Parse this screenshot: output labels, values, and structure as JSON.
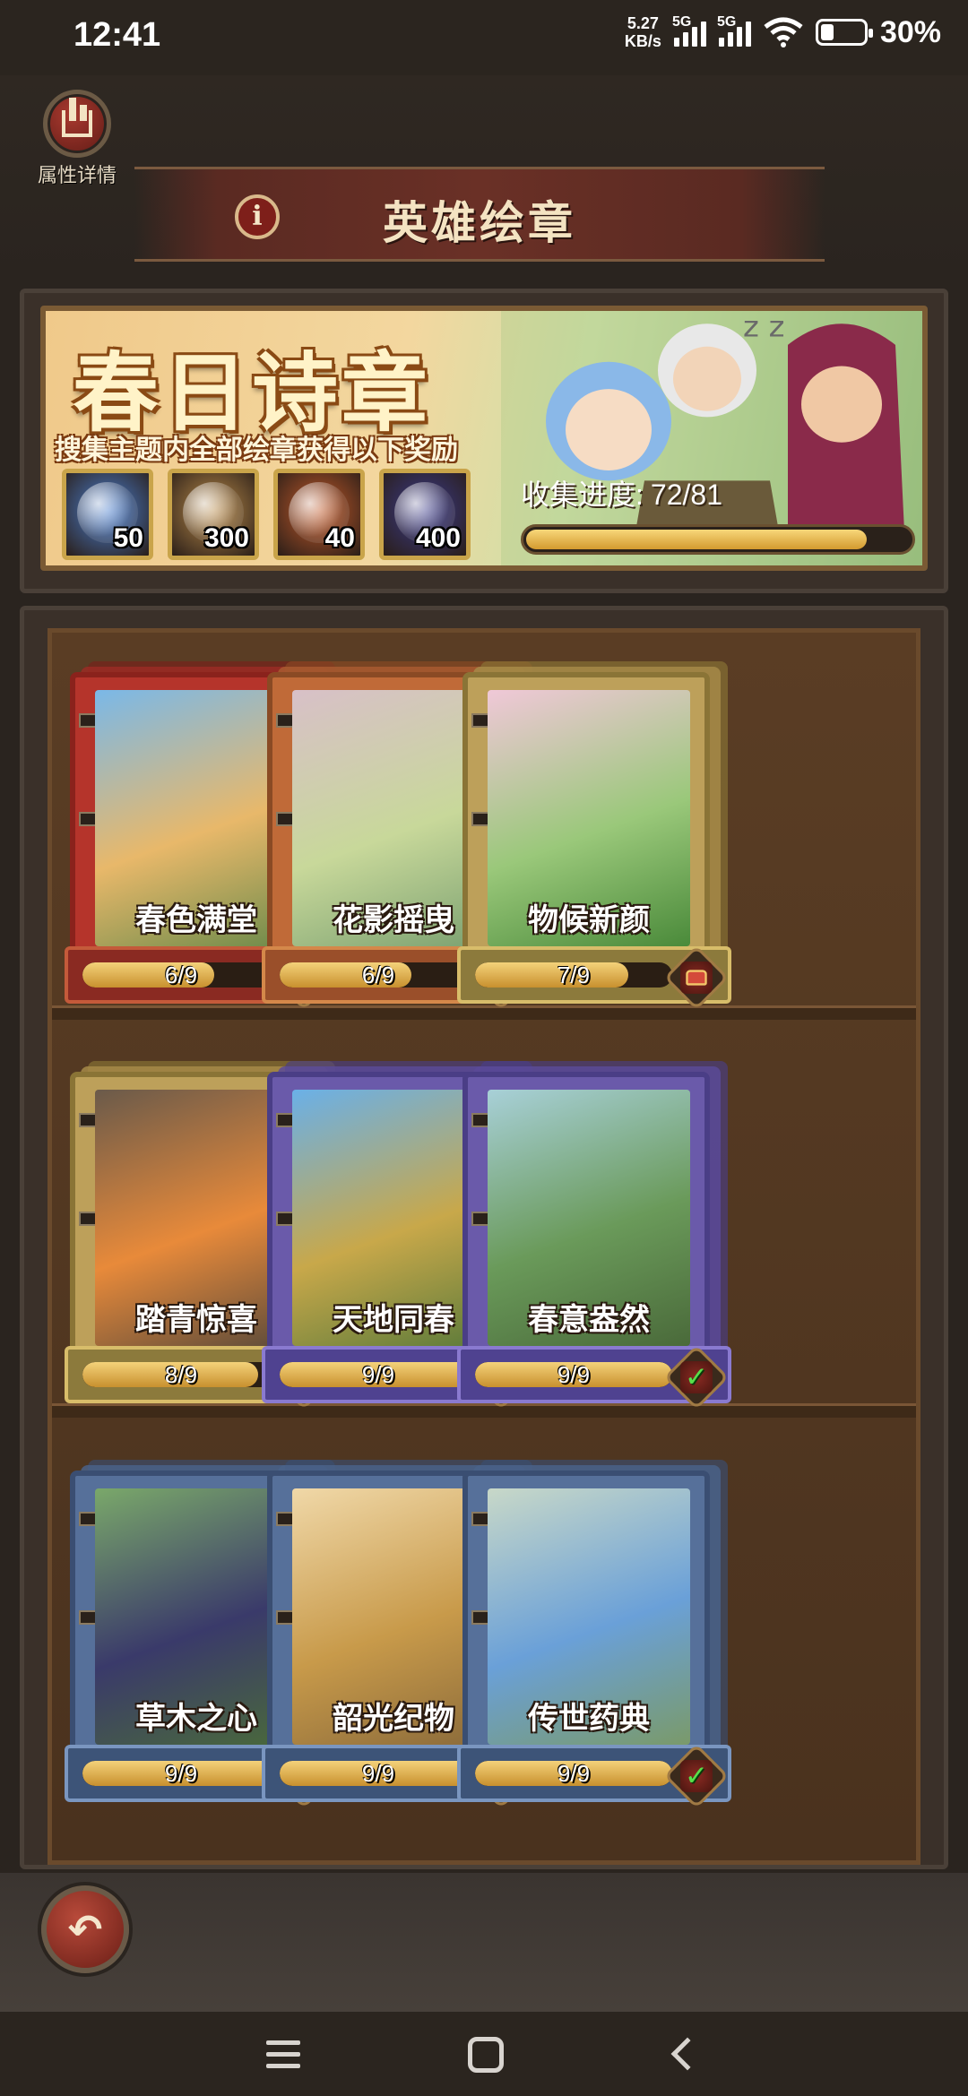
{
  "status_bar": {
    "time": "12:41",
    "net_speed_value": "5.27",
    "net_speed_unit": "KB/s",
    "signal1_label": "5G",
    "signal2_label": "5G",
    "battery_percent": "30%",
    "battery_level": 0.3,
    "icons": [
      "signal-icon",
      "wifi-icon",
      "battery-icon"
    ]
  },
  "header": {
    "attr_button_label": "属性详情",
    "info_icon_glyph": "i",
    "title": "英雄绘章"
  },
  "event": {
    "title": "春日诗章",
    "description": "搜集主题内全部绘章获得以下奖励",
    "rewards": [
      {
        "icon": "snowflake-orb-icon",
        "count": "50",
        "color": "#4a7fd0"
      },
      {
        "icon": "scroll-icon",
        "count": "300",
        "color": "#b98b4a"
      },
      {
        "icon": "golden-wing-icon",
        "count": "40",
        "color": "#c25a2a"
      },
      {
        "icon": "feather-icon",
        "count": "400",
        "color": "#3a3a8a"
      }
    ],
    "progress_label": "收集进度:",
    "progress_value": "72/81",
    "progress_fraction": 0.8889
  },
  "albums": [
    {
      "name": "春色满堂",
      "progress": "6/9",
      "fraction": 0.667,
      "theme": "red",
      "status": "reward-chest-icon",
      "art": [
        "#7ab8e8",
        "#e8b86a",
        "#6a8a4a"
      ]
    },
    {
      "name": "花影摇曳",
      "progress": "6/9",
      "fraction": 0.667,
      "theme": "orange",
      "status": "reward-chest-icon",
      "art": [
        "#d8c0c8",
        "#c8d89a",
        "#7aa070"
      ]
    },
    {
      "name": "物候新颜",
      "progress": "7/9",
      "fraction": 0.778,
      "theme": "gold",
      "status": "reward-chest-icon",
      "art": [
        "#f0c8d8",
        "#9ac87a",
        "#4a8a3a"
      ]
    },
    {
      "name": "踏青惊喜",
      "progress": "8/9",
      "fraction": 0.889,
      "theme": "gold",
      "status": "reward-chest-icon",
      "art": [
        "#6a5a4a",
        "#e88a3a",
        "#5a4a3a"
      ]
    },
    {
      "name": "天地同春",
      "progress": "9/9",
      "fraction": 1.0,
      "theme": "purple",
      "status": "check-icon",
      "art": [
        "#6ab0e8",
        "#c8a84a",
        "#5a7a3a"
      ]
    },
    {
      "name": "春意盎然",
      "progress": "9/9",
      "fraction": 1.0,
      "theme": "purple",
      "status": "check-icon",
      "art": [
        "#a8d0d8",
        "#6a9a5a",
        "#4a6a3a"
      ]
    },
    {
      "name": "草木之心",
      "progress": "9/9",
      "fraction": 1.0,
      "theme": "blue",
      "status": "check-icon",
      "art": [
        "#7aa86a",
        "#3a3a6a",
        "#4a6a3a"
      ]
    },
    {
      "name": "韶光纪物",
      "progress": "9/9",
      "fraction": 1.0,
      "theme": "blue",
      "status": "check-icon",
      "art": [
        "#f0d8a8",
        "#c89a4a",
        "#8a6a3a"
      ]
    },
    {
      "name": "传世药典",
      "progress": "9/9",
      "fraction": 1.0,
      "theme": "blue",
      "status": "check-icon",
      "art": [
        "#c8d8c8",
        "#6aa0d8",
        "#7a9a6a"
      ]
    }
  ],
  "bottom": {
    "back_icon": "return-arrow-icon"
  },
  "nav_bar": {
    "icons": [
      "menu-icon",
      "home-icon",
      "back-icon"
    ]
  }
}
